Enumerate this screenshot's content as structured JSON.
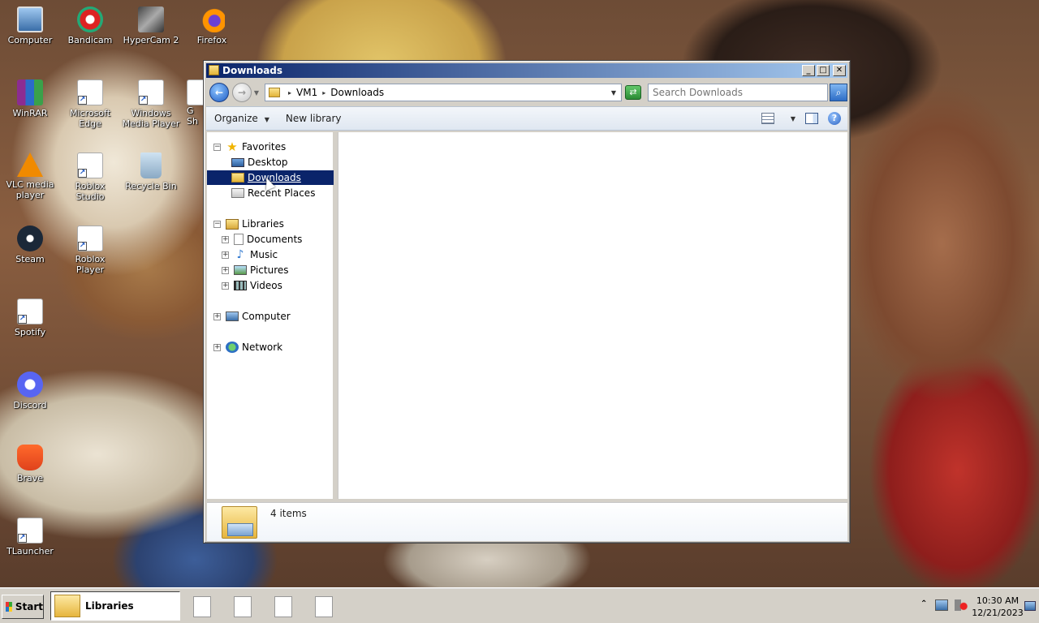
{
  "desktop": {
    "icons": [
      {
        "label": "Computer",
        "icon": "computer-icon"
      },
      {
        "label": "Bandicam",
        "icon": "bandicam-icon"
      },
      {
        "label": "HyperCam 2",
        "icon": "hypercam-icon"
      },
      {
        "label": "Firefox",
        "icon": "firefox-icon"
      },
      {
        "label": "WinRAR",
        "icon": "winrar-icon"
      },
      {
        "label": "Microsoft Edge",
        "icon": "shortcut-icon"
      },
      {
        "label": "Windows Media Player",
        "icon": "shortcut-icon"
      },
      {
        "label": "VLC media player",
        "icon": "vlc-icon"
      },
      {
        "label": "Roblox Studio",
        "icon": "shortcut-icon"
      },
      {
        "label": "Recycle Bin",
        "icon": "recycle-bin-icon"
      },
      {
        "label": "Steam",
        "icon": "steam-icon"
      },
      {
        "label": "Roblox Player",
        "icon": "shortcut-icon"
      },
      {
        "label": "Spotify",
        "icon": "shortcut-icon"
      },
      {
        "label": "Discord",
        "icon": "discord-icon"
      },
      {
        "label": "Brave",
        "icon": "brave-icon"
      },
      {
        "label": "TLauncher",
        "icon": "shortcut-icon"
      }
    ],
    "partial_label": "G Sh"
  },
  "window": {
    "title": "Downloads",
    "buttons": {
      "minimize": "_",
      "maximize": "□",
      "close": "✕"
    },
    "address": {
      "crumbs": [
        "VM1",
        "Downloads"
      ],
      "separator": "▸"
    },
    "search": {
      "placeholder": "Search Downloads"
    },
    "toolbar": {
      "organize": "Organize",
      "new_library": "New library"
    },
    "nav": {
      "favorites": {
        "label": "Favorites",
        "items": [
          "Desktop",
          "Downloads",
          "Recent Places"
        ]
      },
      "libraries": {
        "label": "Libraries",
        "items": [
          "Documents",
          "Music",
          "Pictures",
          "Videos"
        ]
      },
      "computer": "Computer",
      "network": "Network",
      "selected": "Downloads"
    },
    "details": {
      "count": "4 items"
    }
  },
  "taskbar": {
    "start": "Start",
    "active_task": "Libraries",
    "pinned_count": 4,
    "clock_time": "10:30 AM",
    "clock_date": "12/21/2023"
  },
  "colors": {
    "selection": "#0a246a",
    "titlebar_start": "#0a246a",
    "titlebar_end": "#a6caf0",
    "chrome": "#d4d0c8"
  }
}
